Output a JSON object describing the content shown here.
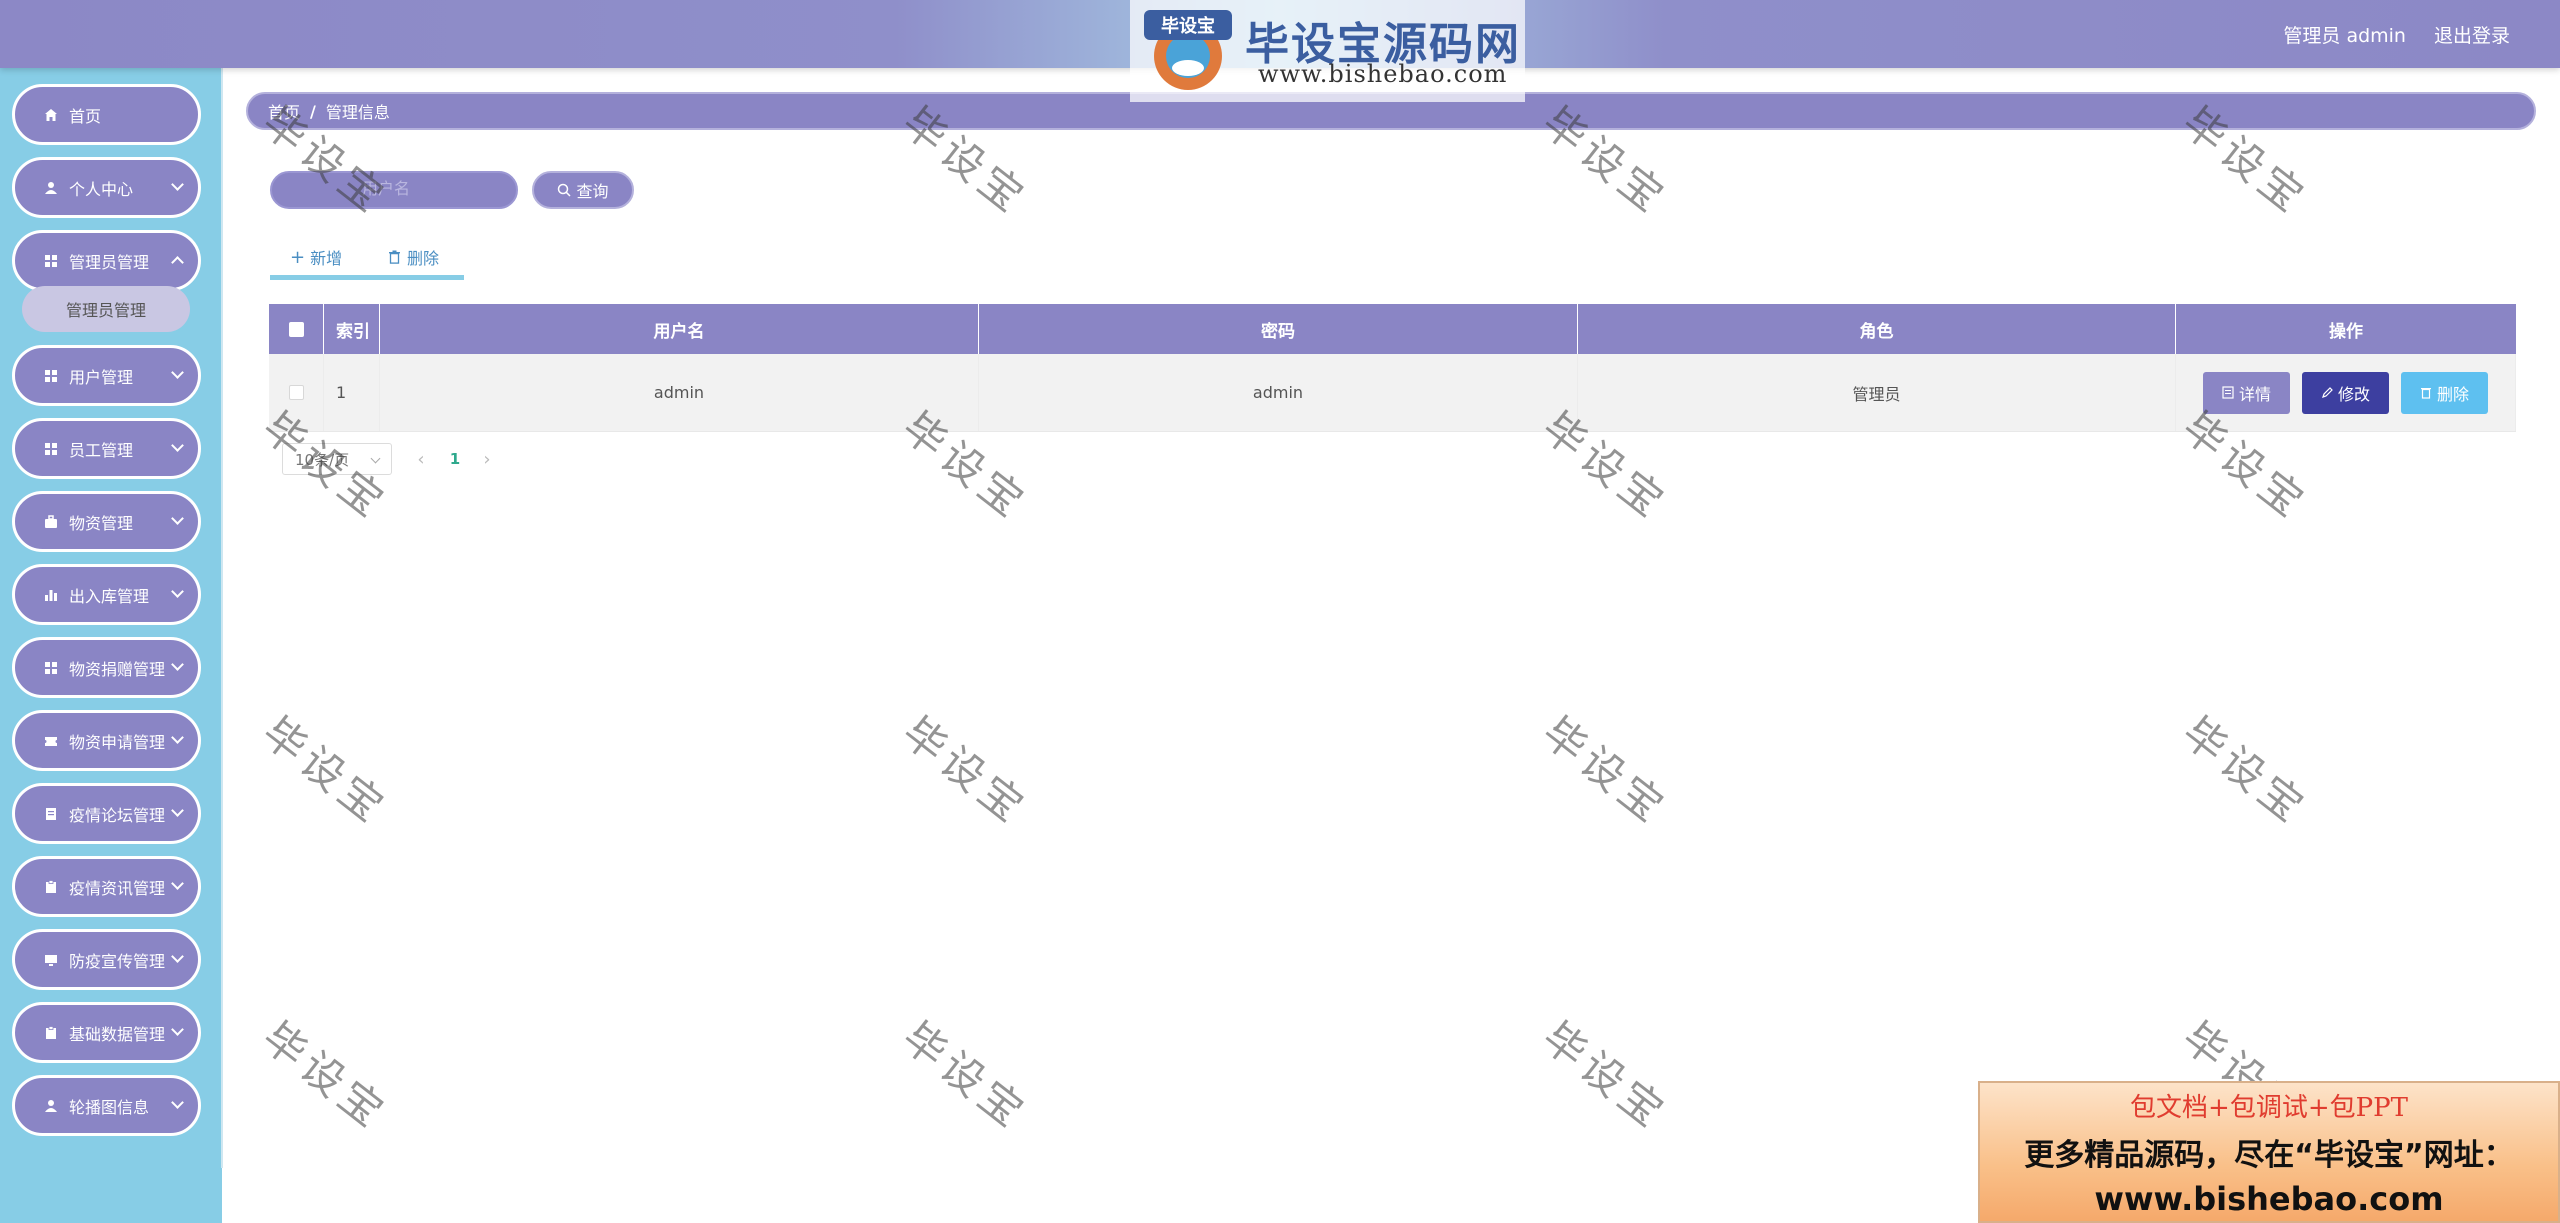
{
  "header": {
    "user_label": "管理员 admin",
    "logout_label": "退出登录"
  },
  "brand": {
    "emblem_text": "毕设宝",
    "title": "毕设宝源码网",
    "url": "www.bishebao.com"
  },
  "sidebar": {
    "items": [
      {
        "label": "首页",
        "icon": "home-icon"
      },
      {
        "label": "个人中心",
        "icon": "user-icon"
      },
      {
        "label": "管理员管理",
        "icon": "grid-icon"
      },
      {
        "label": "用户管理",
        "icon": "grid-icon"
      },
      {
        "label": "员工管理",
        "icon": "grid-icon"
      },
      {
        "label": "物资管理",
        "icon": "briefcase-icon"
      },
      {
        "label": "出入库管理",
        "icon": "bar-chart-icon"
      },
      {
        "label": "物资捐赠管理",
        "icon": "grid-icon"
      },
      {
        "label": "物资申请管理",
        "icon": "ticket-icon"
      },
      {
        "label": "疫情论坛管理",
        "icon": "document-icon"
      },
      {
        "label": "疫情资讯管理",
        "icon": "clipboard-icon"
      },
      {
        "label": "防疫宣传管理",
        "icon": "monitor-icon"
      },
      {
        "label": "基础数据管理",
        "icon": "clipboard-icon"
      },
      {
        "label": "轮播图信息",
        "icon": "user-icon"
      }
    ],
    "submenu_label": "管理员管理"
  },
  "breadcrumb": {
    "home": "首页",
    "separator": "/",
    "current": "管理信息"
  },
  "search": {
    "placeholder": "用户名",
    "button_label": "查询"
  },
  "actions": {
    "add_label": "新增",
    "delete_label": "删除"
  },
  "table": {
    "headers": [
      "索引",
      "用户名",
      "密码",
      "角色",
      "操作"
    ],
    "rows": [
      {
        "index": "1",
        "username": "admin",
        "password": "admin",
        "role": "管理员"
      }
    ],
    "row_actions": {
      "detail": "详情",
      "edit": "修改",
      "delete": "删除"
    }
  },
  "pagination": {
    "page_size": "10条/页",
    "current_page": "1"
  },
  "watermark": "毕设宝",
  "ad": {
    "line1": "包文档+包调试+包PPT",
    "line2": "更多精品源码，尽在“毕设宝”网址：",
    "line3": "www.bishebao.com"
  },
  "colors": {
    "accent": "#8a85c5",
    "sidebar_bg": "#87cde6",
    "edit_button": "#3d3fa0",
    "delete_button": "#5ec0f0",
    "page_active": "#2fa98d"
  }
}
